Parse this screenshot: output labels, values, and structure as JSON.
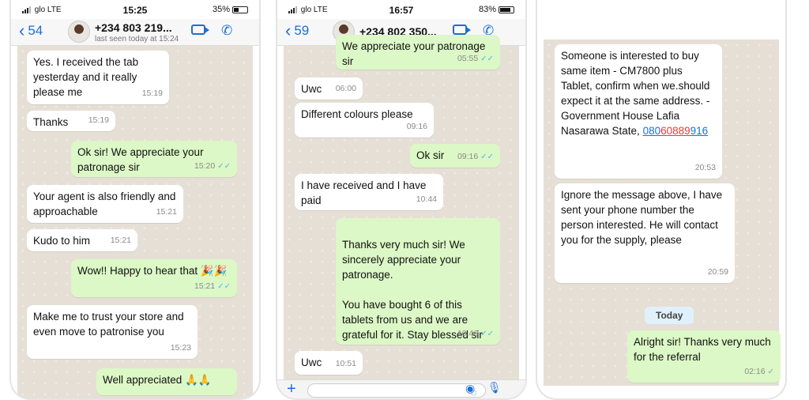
{
  "screens": [
    {
      "status": {
        "carrier": "glo",
        "network": "LTE",
        "time": "15:25",
        "battery": "35%",
        "battery_level": 0.35
      },
      "header": {
        "back_count": "54",
        "contact": "+234 803 219...",
        "subtitle": "last seen today at 15:24"
      },
      "messages": [
        {
          "text": "Yes. I received the tab yesterday and  it really please me",
          "time": "15:19",
          "dir": "in"
        },
        {
          "text": "Thanks",
          "time": "15:19",
          "dir": "in"
        },
        {
          "text": "Ok sir! We appreciate your patronage sir",
          "time": "15:20",
          "dir": "out"
        },
        {
          "text": "Your agent is also friendly and approachable",
          "time": "15:21",
          "dir": "in"
        },
        {
          "text": "Kudo to him",
          "time": "15:21",
          "dir": "in"
        },
        {
          "text": "Wow!! Happy to hear that 🎉🎉",
          "time": "15:21",
          "dir": "out"
        },
        {
          "text": "Make me to trust your store and even move to patronise you",
          "time": "15:23",
          "dir": "in"
        },
        {
          "text": "Well appreciated 🙏🙏",
          "time": "",
          "dir": "out"
        }
      ]
    },
    {
      "status": {
        "carrier": "glo",
        "network": "LTE",
        "time": "16:57",
        "battery": "83%",
        "battery_level": 0.83
      },
      "header": {
        "back_count": "59",
        "contact": "+234 802 350..."
      },
      "messages": [
        {
          "text": "We appreciate your patronage sir",
          "time": "05:55",
          "dir": "out"
        },
        {
          "text": "Uwc",
          "time": "06:00",
          "dir": "in"
        },
        {
          "text": "Different colours please",
          "time": "09:16",
          "dir": "in"
        },
        {
          "text": "Ok sir",
          "time": "09:16",
          "dir": "out"
        },
        {
          "text": "I have received and I have paid",
          "time": "10:44",
          "dir": "in"
        },
        {
          "text": "Thanks very much sir! We sincerely appreciate your patronage.\n\nYou have bought 6 of this tablets from us and we are grateful for it. Stay blessed sir",
          "time": "10:46",
          "dir": "out"
        },
        {
          "text": "Uwc",
          "time": "10:51",
          "dir": "in"
        }
      ]
    },
    {
      "messages": [
        {
          "text": "Someone is interested to buy same item - CM7800 plus Tablet, confirm when we.should expect it at the same address. - Government House Lafia Nasarawa State,",
          "link_visible": "080",
          "link_redacted": "60889",
          "link_tail": "916",
          "time": "20:53",
          "dir": "in"
        },
        {
          "text": "Ignore the message above, I have sent your phone number the person interested. He will contact you for the supply, please",
          "time": "20:59",
          "dir": "in"
        },
        {
          "text": "Alright sir! Thanks very much for the referral",
          "time": "02:16",
          "dir": "out"
        }
      ],
      "date_chip": "Today"
    }
  ],
  "icons": {
    "back": "chevron-left-icon",
    "video": "video-camera-icon",
    "call": "phone-icon",
    "tick": "double-tick-icon"
  }
}
